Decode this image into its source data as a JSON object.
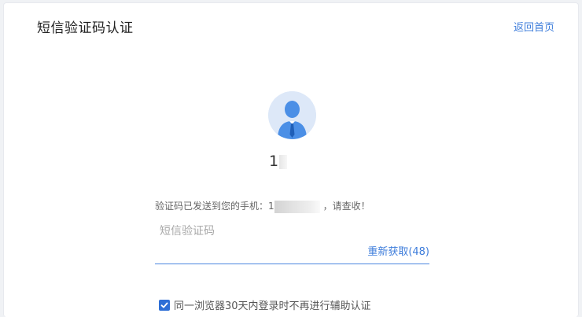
{
  "header": {
    "title": "短信验证码认证",
    "back_label": "返回首页"
  },
  "user": {
    "avatar_icon": "user-avatar-icon",
    "number_visible": "1"
  },
  "verification": {
    "sent_prefix": "验证码已发送到您的手机：1",
    "sent_suffix": "，请查收！",
    "code_placeholder": "短信验证码",
    "code_value": "",
    "resend_label": "重新获取(48)"
  },
  "remember": {
    "checked": true,
    "label": "同一浏览器30天内登录时不再进行辅助认证"
  },
  "colors": {
    "accent": "#3e7ddb",
    "checkbox": "#2e6fd6",
    "avatar_bg": "#dde8f8",
    "avatar_figure": "#4b8fe6"
  }
}
